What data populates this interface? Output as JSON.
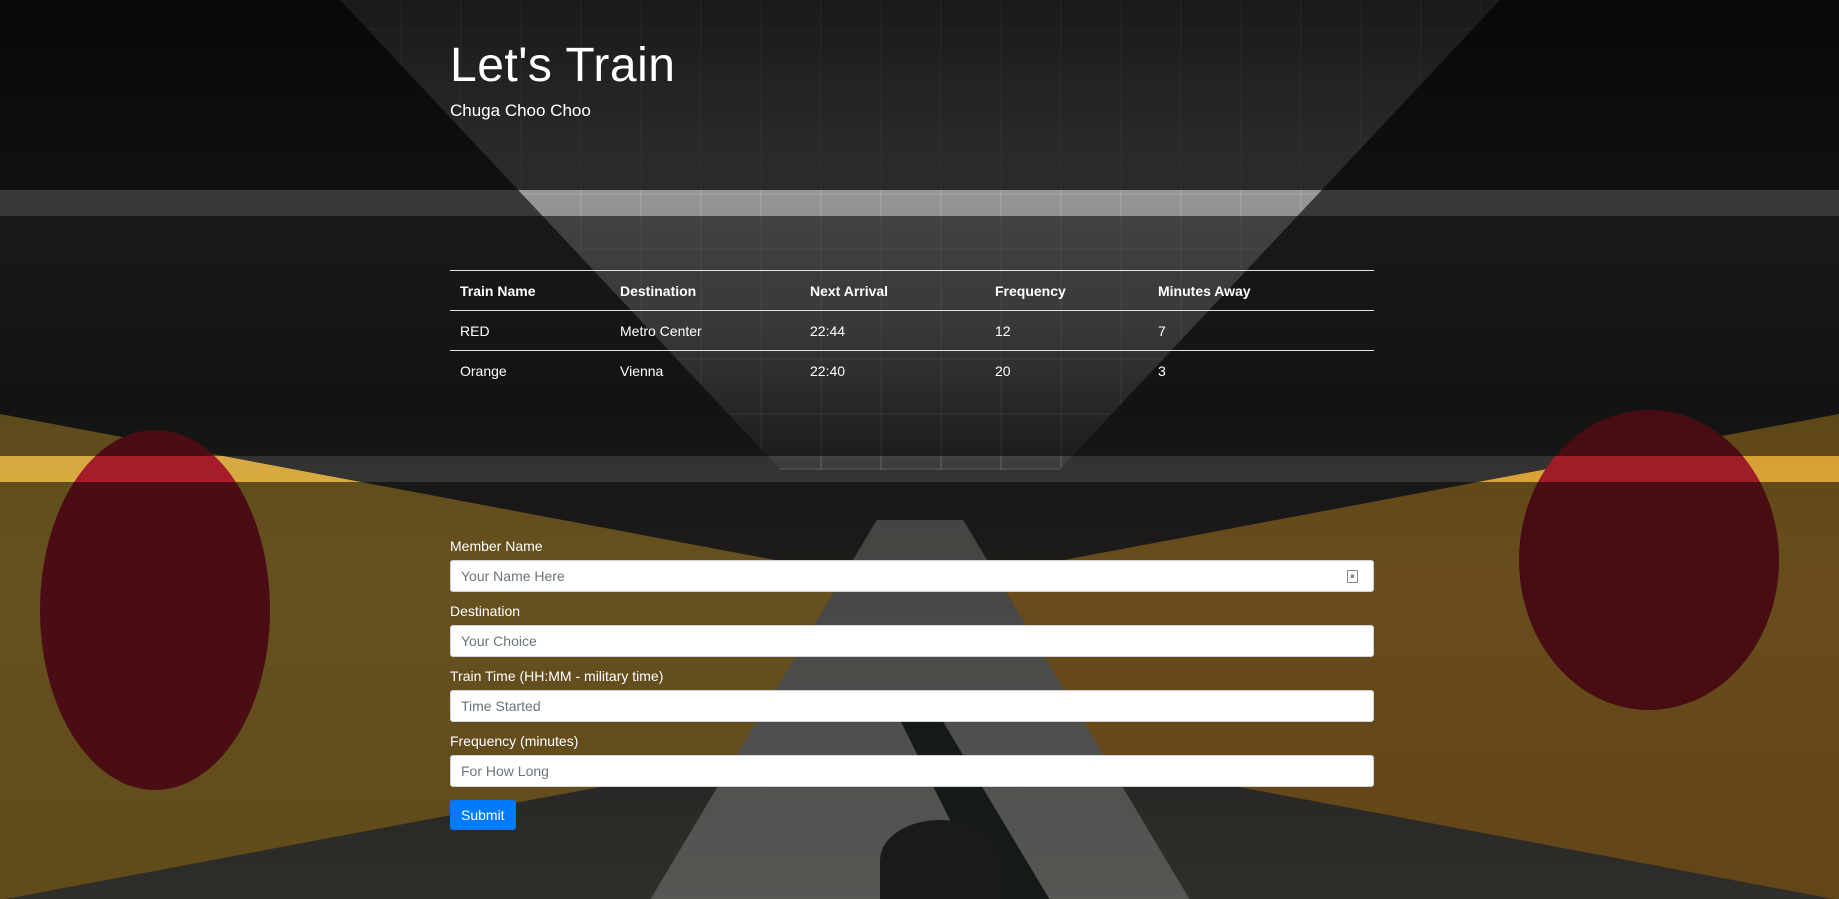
{
  "header": {
    "title": "Let's Train",
    "subtitle": "Chuga Choo Choo"
  },
  "schedule": {
    "columns": [
      "Train Name",
      "Destination",
      "Next Arrival",
      "Frequency",
      "Minutes Away"
    ],
    "rows": [
      [
        "RED",
        "Metro Center",
        "22:44",
        "12",
        "7"
      ],
      [
        "Orange",
        "Vienna",
        "22:40",
        "20",
        "3"
      ]
    ]
  },
  "form": {
    "fields": [
      {
        "label": "Member Name",
        "placeholder": "Your Name Here"
      },
      {
        "label": "Destination",
        "placeholder": "Your Choice"
      },
      {
        "label": "Train Time (HH:MM - military time)",
        "placeholder": "Time Started"
      },
      {
        "label": "Frequency (minutes)",
        "placeholder": "For How Long"
      }
    ],
    "submit_label": "Submit"
  },
  "colors": {
    "button": "#007bff",
    "overlay": "#000000"
  },
  "icons": {
    "autofill": "contact-card-icon"
  }
}
